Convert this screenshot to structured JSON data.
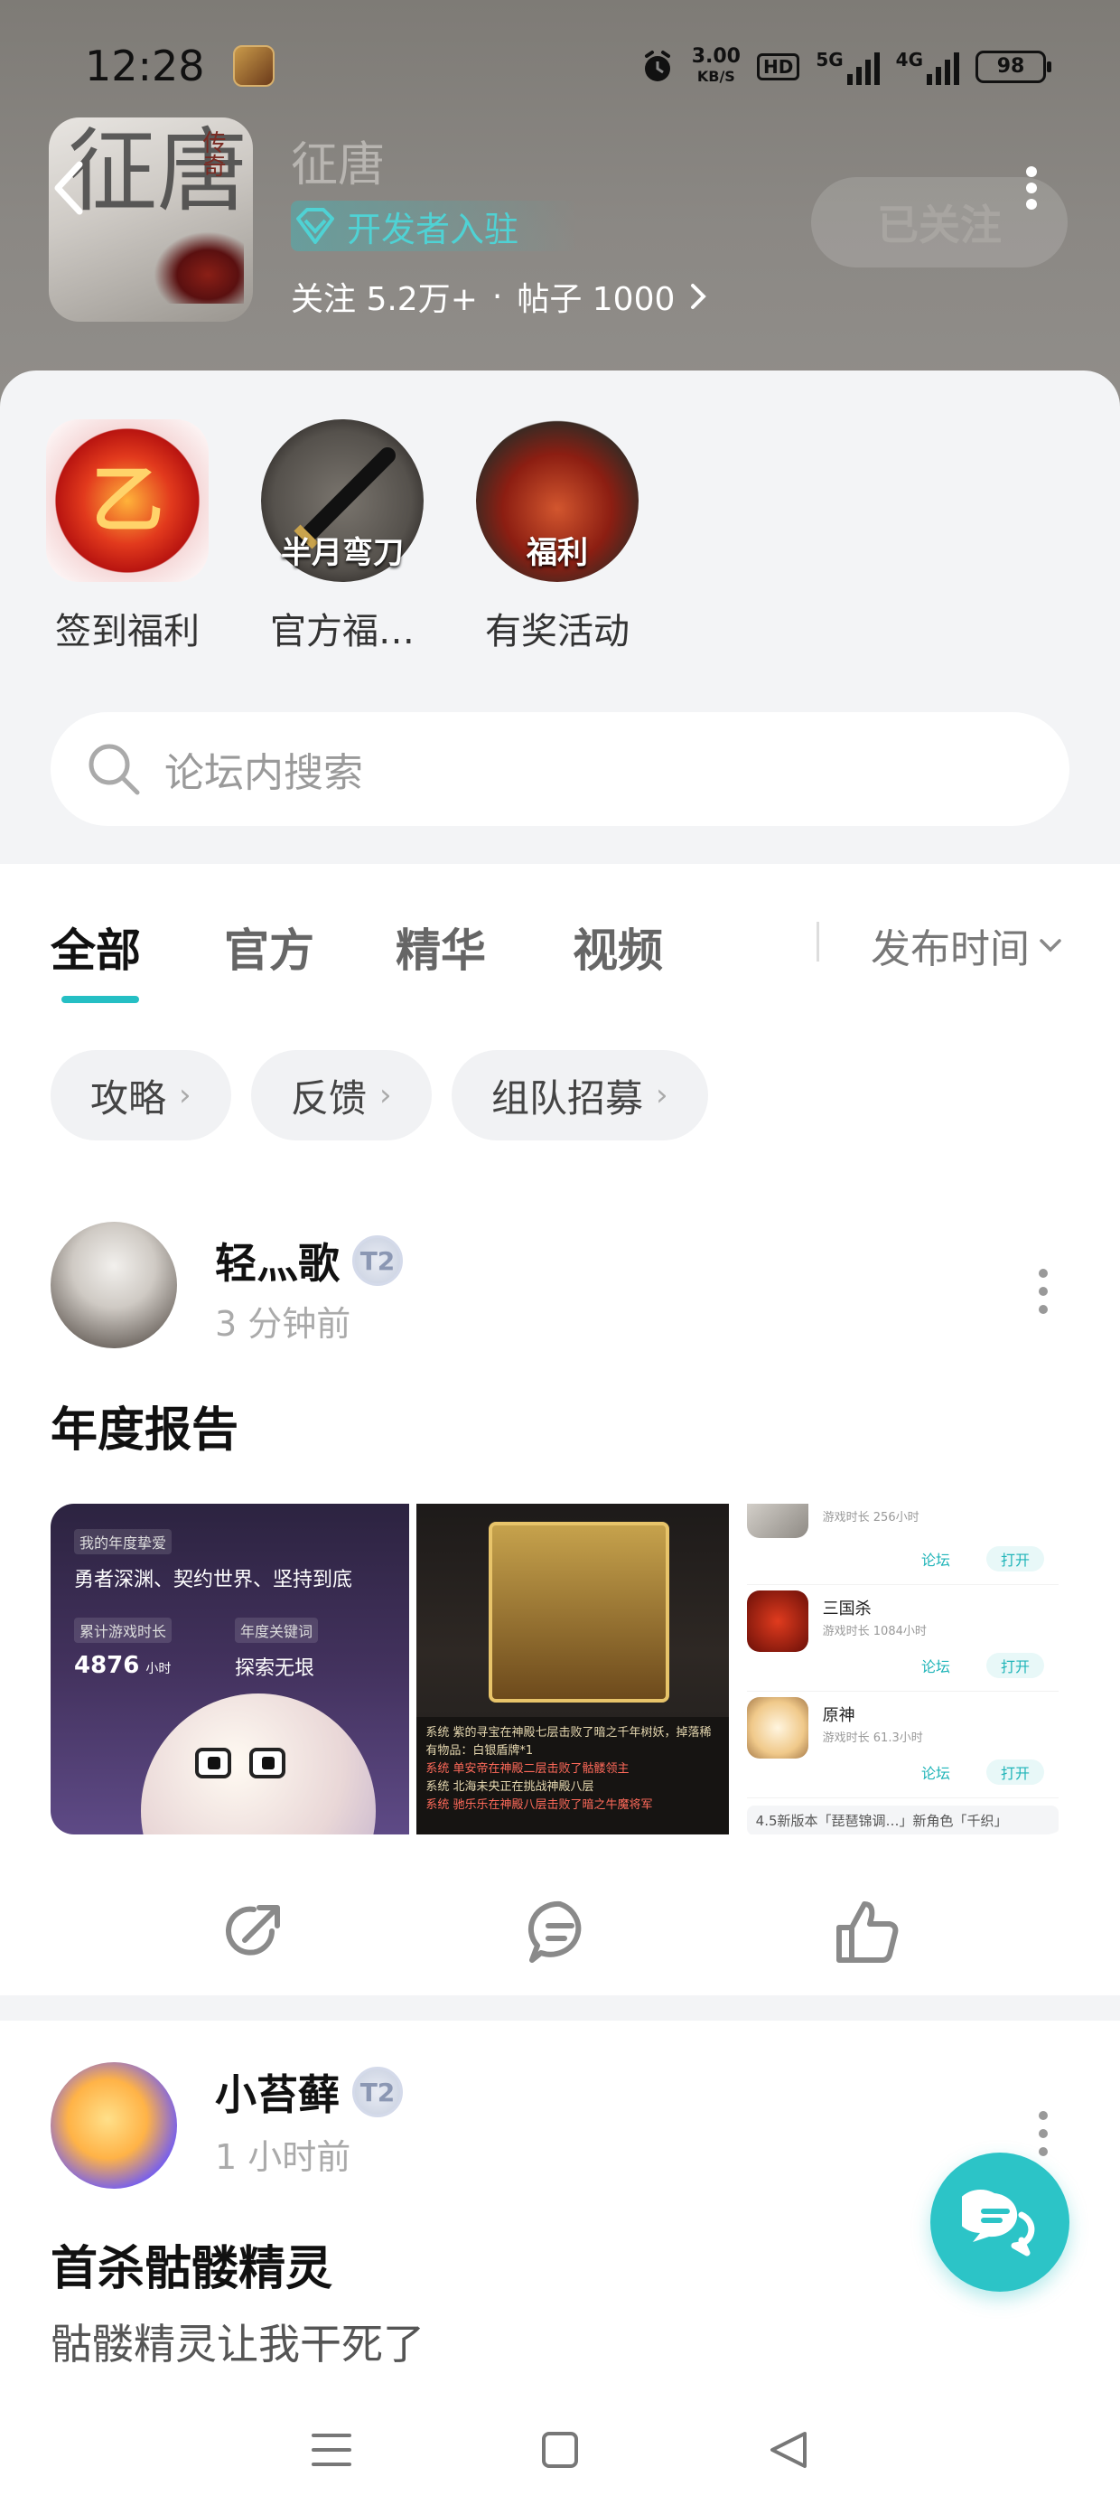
{
  "status_bar": {
    "time": "12:28",
    "net_speed_value": "3.00",
    "net_speed_unit": "KB/S",
    "hd_label": "HD",
    "signal_1_label": "5G",
    "signal_2_label": "4G",
    "battery": "98"
  },
  "forum": {
    "name": "征唐",
    "logo_text": "征唐",
    "logo_small": "传奇",
    "developer_badge": "开发者入驻",
    "follow_count_label": "关注 5.2万+",
    "dot": "·",
    "post_count_label": "帖子 1000",
    "follow_button": "已关注"
  },
  "quick_entries": [
    {
      "label": "签到福利",
      "icon": "sign-in-reward-icon",
      "overlay": ""
    },
    {
      "label": "官方福…",
      "icon": "official-welfare-icon",
      "overlay": "半月弯刀"
    },
    {
      "label": "有奖活动",
      "icon": "prize-activity-icon",
      "overlay": "福利"
    }
  ],
  "search": {
    "placeholder": "论坛内搜索"
  },
  "tabs": [
    {
      "label": "全部",
      "active": true
    },
    {
      "label": "官方",
      "active": false
    },
    {
      "label": "精华",
      "active": false
    },
    {
      "label": "视频",
      "active": false
    }
  ],
  "sort_label": "发布时间",
  "chips": [
    {
      "label": "攻略"
    },
    {
      "label": "反馈"
    },
    {
      "label": "组队招募"
    }
  ],
  "posts": [
    {
      "username": "轻灬歌",
      "level": "T2",
      "time": "3 分钟前",
      "title": "年度报告",
      "images": {
        "report": {
          "fav_label": "我的年度挚爱",
          "fav_value": "勇者深渊、契约世界、坚持到底",
          "hours_label": "累计游戏时长",
          "hours_value": "4876",
          "hours_unit": "小时",
          "keyword_label": "年度关键词",
          "keyword_value": "探索无垠"
        },
        "game_chat": {
          "lines": [
            "系统 紫的寻宝在神殿七层击败了暗之千年树妖，掉落稀有物品：白银盾牌*1",
            "系统 单安帝在神殿二层击败了骷髅领主",
            "系统 北海未央正在挑战神殿八层",
            "系统 驰乐乐在神殿八层击败了暗之牛魔将军"
          ]
        },
        "game_list": [
          {
            "name": "",
            "playtime": "游戏时长 256小时",
            "forum": "论坛",
            "open": "打开"
          },
          {
            "name": "三国杀",
            "playtime": "游戏时长 1084小时",
            "forum": "论坛",
            "open": "打开"
          },
          {
            "name": "原神",
            "playtime": "游戏时长 61.3小时",
            "forum": "论坛",
            "open": "打开"
          }
        ],
        "banner": "4.5新版本「琵琶锦调…」新角色「千织」"
      }
    },
    {
      "username": "小苔藓",
      "level": "T2",
      "time": "1 小时前",
      "title": "首杀骷髅精灵",
      "body": "骷髅精灵让我干死了"
    }
  ],
  "colors": {
    "accent": "#25bfc4",
    "header_bg": "#8b8884",
    "page_bg": "#f3f4f6"
  }
}
